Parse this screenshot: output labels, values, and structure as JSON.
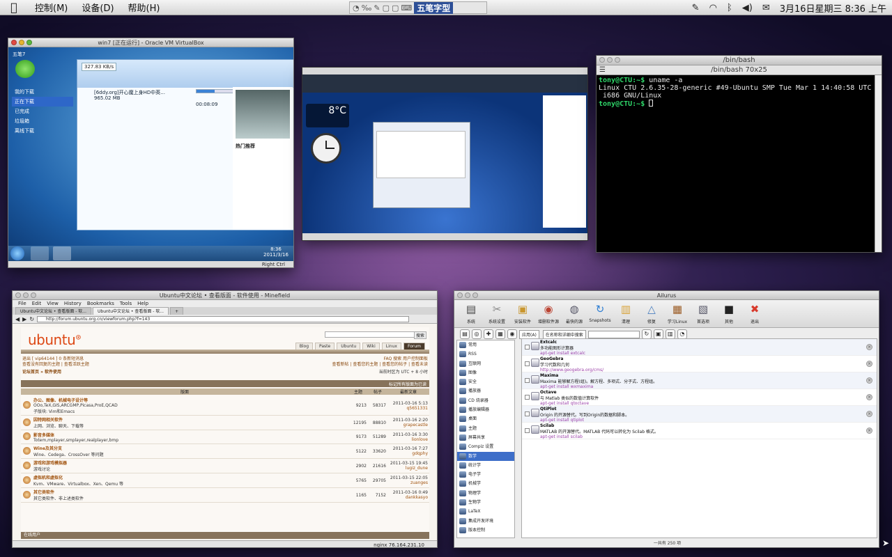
{
  "menubar": {
    "apple": "",
    "menus": [
      "控制(M)",
      "设备(D)",
      "帮助(H)"
    ],
    "ime_name": "五笔字型",
    "datetime": "3月16日星期三 8:36 上午"
  },
  "vbox": {
    "title": "win7 [正在运行] - Oracle VM VirtualBox",
    "speed": "327.83 KB/s",
    "file_name": "[6ddy.org]开心魔上身HD中英...",
    "file_size": "965.02 MB",
    "time": "00:08:09",
    "side_items": [
      "我的下载",
      "正在下载",
      "已完成",
      "垃圾箱",
      "离线下载"
    ],
    "clock": "8:36",
    "date": "2011/3/16",
    "right_ctrl": "Right Ctrl",
    "user": "五笔7",
    "hot": "热门推荐"
  },
  "remote": {
    "temp": "8°C"
  },
  "terminal": {
    "window_title": "/bin/bash",
    "subtitle": "/bin/bash 70x25",
    "prompt1": "tony@CTU:~$",
    "cmd1": " uname -a",
    "output": "Linux CTU 2.6.35-28-generic #49-Ubuntu SMP Tue Mar 1 14:40:58 UTC 2011\n i686 GNU/Linux",
    "prompt2": "tony@CTU:~$"
  },
  "forum": {
    "title": "Ubuntu中文论坛 • 查看版面 - 软件使用 - Minefield",
    "menus": [
      "File",
      "Edit",
      "View",
      "History",
      "Bookmarks",
      "Tools",
      "Help"
    ],
    "tabs": [
      "Ubuntu中文论坛 • 查看版面 - 软...",
      "Ubuntu中文论坛 • 查看版面 - 软..."
    ],
    "url": "http://forum.ubuntu.org.cn/viewforum.php?f=143",
    "logo": "ubuntu",
    "search_button": "搜索",
    "navtabs": [
      "Blog",
      "Paste",
      "Ubuntu",
      "Wiki",
      "Linux",
      "Forum"
    ],
    "user_line": "退出 [ vip64144 ]   0 条新短消息",
    "links_line": "查看没有回复的主题 | 查看活跃主题",
    "links_right": "查看新帖 | 查看您的主题 | 查看您的帖子 | 查看未读",
    "faq": "FAQ   搜索   用户控制面板",
    "breadcrumb": "论坛首页 » 软件使用",
    "timezone": "当前时区为 UTC + 8 小时",
    "mark_read": "标记所有版面为已读",
    "col_forum": "版面",
    "col_topics": "主题",
    "col_posts": "帖子",
    "col_last": "最新文章",
    "rows": [
      {
        "name": "办公、图像、机械电子设计等",
        "desc": "OOo,TeX,GIS,ARCGMP,Picasa,ProE,QCAD",
        "sub": "子版块: Vim和Emacs",
        "topics": "9213",
        "posts": "58317",
        "date": "2011-03-16 5:13",
        "by": "q5651331"
      },
      {
        "name": "因特网相关软件",
        "desc": "上网、浏览、聊天、下载等",
        "sub": "",
        "topics": "12195",
        "posts": "88810",
        "date": "2011-03-16 2:20",
        "by": "grapecastle"
      },
      {
        "name": "影音多媒体",
        "desc": "Totem,mplayer,smplayer,realplayer,bmp",
        "sub": "",
        "topics": "9173",
        "posts": "51289",
        "date": "2011-03-16 3:30",
        "by": "lionlove"
      },
      {
        "name": "Wine及其分支",
        "desc": "Wine、Cedega、CrossOver 等问题",
        "sub": "",
        "topics": "5122",
        "posts": "33620",
        "date": "2011-03-16 7:27",
        "by": "gdqphy"
      },
      {
        "name": "游戏和游戏模拟器",
        "desc": "游戏讨论",
        "sub": "",
        "topics": "2902",
        "posts": "21616",
        "date": "2011-03-15 19:45",
        "by": "lugiz_dune"
      },
      {
        "name": "虚拟机和虚拟化",
        "desc": "Kvm、VMware、Virtualbox、Xen、Qemu 等",
        "sub": "",
        "topics": "5765",
        "posts": "29705",
        "date": "2011-03-15 22:05",
        "by": "zuanges"
      },
      {
        "name": "其它类软件",
        "desc": "其它类软件、非上述类软件",
        "sub": "",
        "topics": "1165",
        "posts": "7152",
        "date": "2011-03-16 0:49",
        "by": "dankkasyo"
      }
    ],
    "online": "在线用户",
    "statusbar": "nginx   76.164.231.10"
  },
  "ailurus": {
    "title": "Ailurus",
    "tools": [
      {
        "label": "系统",
        "icon": "system-icon",
        "glyph": "▤"
      },
      {
        "label": "系统设置",
        "icon": "tools-icon",
        "glyph": "✂"
      },
      {
        "label": "安装软件",
        "icon": "box-icon",
        "glyph": "▣"
      },
      {
        "label": "增删软件源",
        "icon": "repo-icon",
        "glyph": "◉"
      },
      {
        "label": "最快的源",
        "icon": "globe-icon",
        "glyph": "◍"
      },
      {
        "label": "Snapshots",
        "icon": "snapshot-icon",
        "glyph": "↻"
      },
      {
        "label": "清理",
        "icon": "clean-icon",
        "glyph": "▥"
      },
      {
        "label": "修复",
        "icon": "fix-icon",
        "glyph": "△"
      },
      {
        "label": "学习Linux",
        "icon": "book-icon",
        "glyph": "▦"
      },
      {
        "label": "首选项",
        "icon": "prefs-icon",
        "glyph": "▧"
      },
      {
        "label": "其他",
        "icon": "other-icon",
        "glyph": "■"
      },
      {
        "label": "退出",
        "icon": "quit-icon",
        "glyph": "✖"
      }
    ],
    "apply_button": "应用(A)",
    "filter": "在名称和详细中搜索",
    "categories": [
      "常用",
      "RSS",
      "互联网",
      "图像",
      "安全",
      "播放器",
      "CD 烧录器",
      "播放编辑器",
      "桌面",
      "主题",
      "屏幕共享",
      "Compiz 设置",
      "数学",
      "统计学",
      "电子学",
      "机械学",
      "物理学",
      "生物学",
      "LaTeX",
      "集成开发环境",
      "版本控制"
    ],
    "selected_category": "数学",
    "items": [
      {
        "name": "Extcalc",
        "desc": "多功能图形计算器",
        "cmd": "apt-get install extcalc"
      },
      {
        "name": "GeoGebra",
        "desc": "学习代数和几何",
        "cmd": "http://www.geogebra.org/cms/"
      },
      {
        "name": "Maxima",
        "desc": "Maxima 能够解方程(组)。解方程、多项式、分子式、方程组。",
        "cmd": "apt-get install wxmaxima"
      },
      {
        "name": "Octave",
        "desc": "与 Matlab 类似的数值计算软件",
        "cmd": "apt-get install qtoctave"
      },
      {
        "name": "QtiPlot",
        "desc": "Origin 的开源替代。写到Origin的数据和脚本。",
        "cmd": "apt-get install qtiplot"
      },
      {
        "name": "Scilab",
        "desc": "MATLAB 的开源替代。MATLAB 代码可以转化为 Scilab 格式。",
        "cmd": "apt-get install scilab"
      }
    ],
    "footer": "一共有 250 项"
  }
}
